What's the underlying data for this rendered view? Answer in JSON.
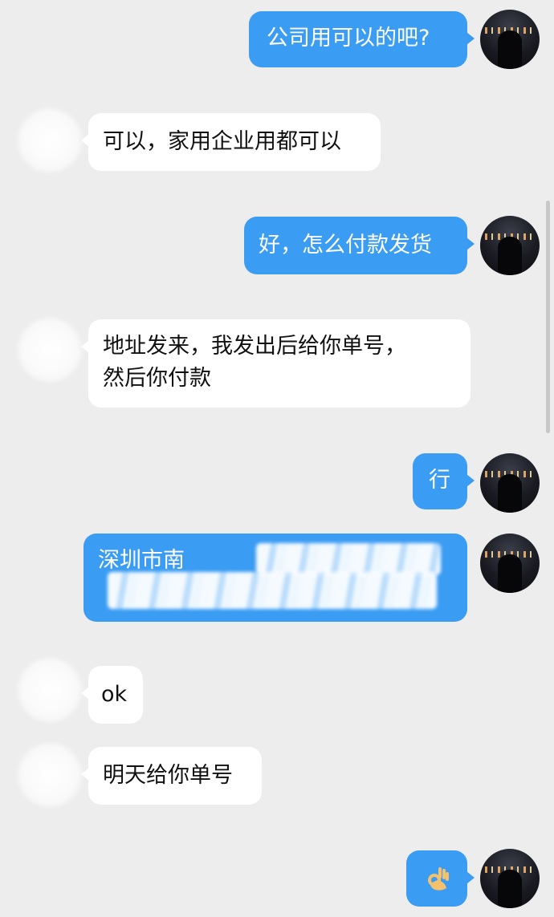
{
  "colors": {
    "background": "#eeedee",
    "outgoing_bubble": "#3a9cf3",
    "incoming_bubble": "#ffffff"
  },
  "messages": [
    {
      "direction": "outgoing",
      "text": "公司用可以的吧?"
    },
    {
      "direction": "incoming",
      "text": "可以，家用企业用都可以"
    },
    {
      "direction": "outgoing",
      "text": "好，怎么付款发货"
    },
    {
      "direction": "incoming",
      "lines": [
        "地址发来，我发出后给你单号，",
        "然后你付款"
      ]
    },
    {
      "direction": "outgoing",
      "text": "行"
    },
    {
      "direction": "outgoing",
      "text": "深圳市南"
    },
    {
      "direction": "incoming",
      "text": "ok"
    },
    {
      "direction": "incoming",
      "text": "明天给你单号"
    },
    {
      "direction": "outgoing",
      "emoji": "ok-hand-icon"
    }
  ]
}
